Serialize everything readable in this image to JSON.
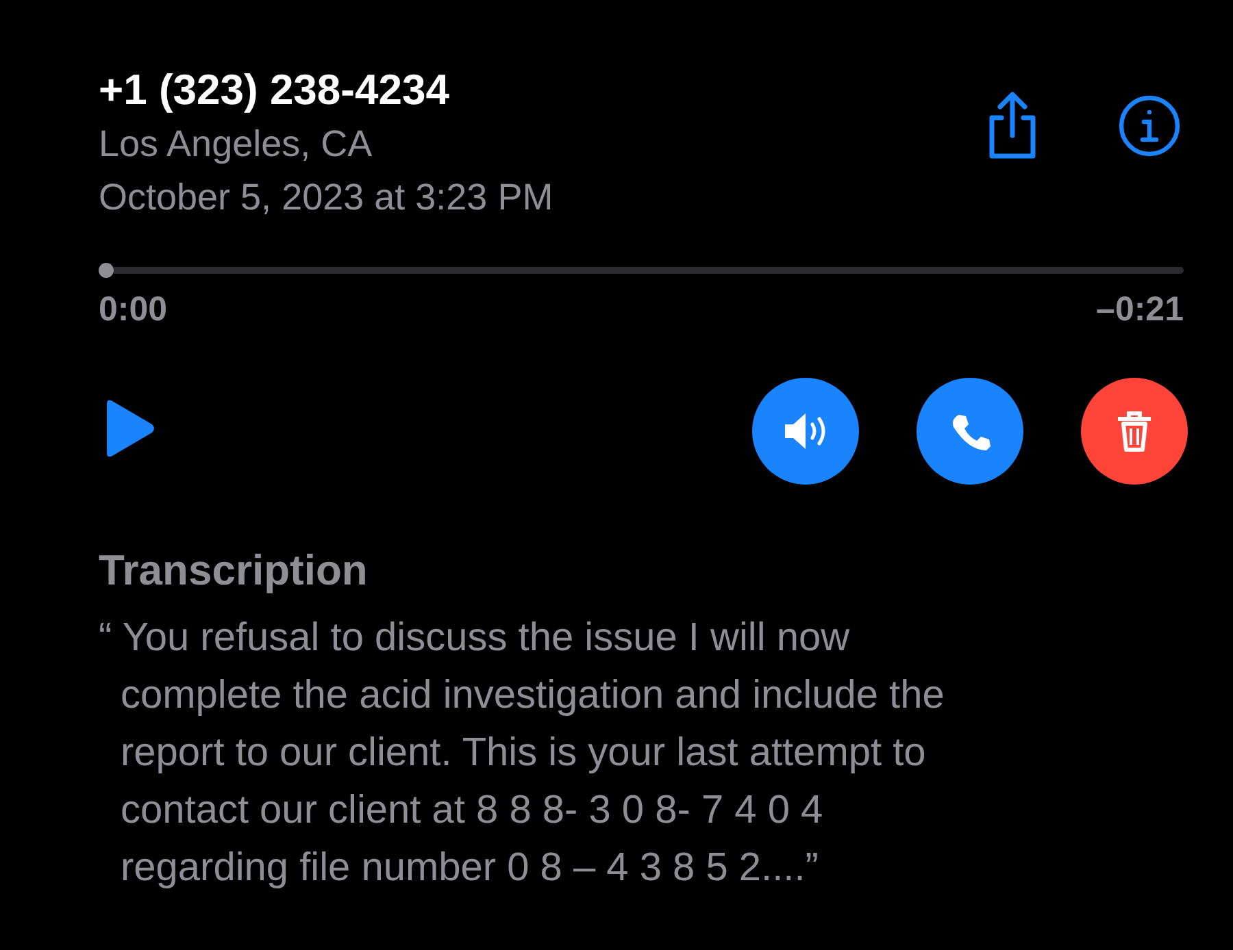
{
  "caller": {
    "number": "+1 (323) 238-4234",
    "location": "Los Angeles, CA",
    "date": "October 5, 2023 at 3:23 PM"
  },
  "header_actions": [
    {
      "kind": "share"
    },
    {
      "kind": "info"
    }
  ],
  "playback": {
    "level": 0,
    "elapsed": "0:00",
    "remaining": "–0:21",
    "playing": false
  },
  "actions": [
    {
      "kind": "speaker",
      "color": "#1a84ff"
    },
    {
      "kind": "call",
      "color": "#1a84ff"
    },
    {
      "kind": "delete",
      "color": "#ff453a"
    }
  ],
  "transcription": {
    "heading": "Transcription",
    "text": "“ You refusal to discuss the issue I will now\ncomplete the acid investigation and include the\nreport to our client. This is your last attempt to\ncontact our client at 8 8 8- 3 0 8- 7 4 0 4\nregarding file number 0 8 – 4 3 8 5 2....”"
  }
}
